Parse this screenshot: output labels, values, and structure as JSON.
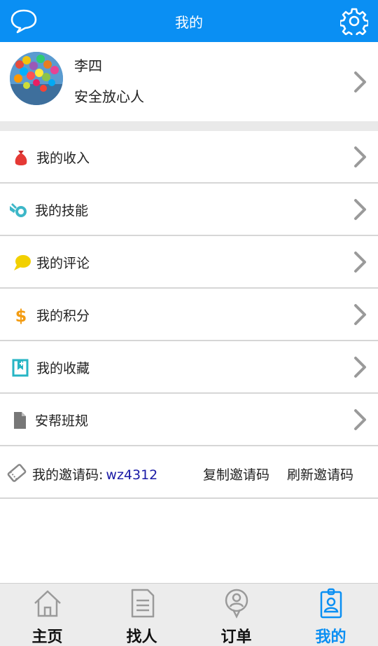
{
  "header": {
    "title": "我的",
    "left_icon": "chat-bubble-icon",
    "right_icon": "gear-icon"
  },
  "profile": {
    "name": "李四",
    "subtitle": "安全放心人"
  },
  "menu": [
    {
      "label": "我的收入",
      "icon": "money-bag-icon",
      "color": "#e53935"
    },
    {
      "label": "我的技能",
      "icon": "skill-tools-icon",
      "color": "#3db7c8"
    },
    {
      "label": "我的评论",
      "icon": "comment-bubble-icon",
      "color": "#f2d000"
    },
    {
      "label": "我的积分",
      "icon": "dollar-icon",
      "color": "#f39c12"
    },
    {
      "label": "我的收藏",
      "icon": "bookmark-icon",
      "color": "#26b5c4"
    },
    {
      "label": "安帮班规",
      "icon": "document-icon",
      "color": "#777777"
    }
  ],
  "invite": {
    "label": "我的邀请码:",
    "code": "wz4312",
    "copy_label": "复制邀请码",
    "refresh_label": "刷新邀请码"
  },
  "tabs": [
    {
      "label": "主页",
      "icon": "home-icon",
      "active": false
    },
    {
      "label": "找人",
      "icon": "document-list-icon",
      "active": false
    },
    {
      "label": "订单",
      "icon": "pin-user-icon",
      "active": false
    },
    {
      "label": "我的",
      "icon": "id-badge-icon",
      "active": true
    }
  ],
  "colors": {
    "accent": "#0a8ff3",
    "code_text": "#1a1aa6"
  }
}
